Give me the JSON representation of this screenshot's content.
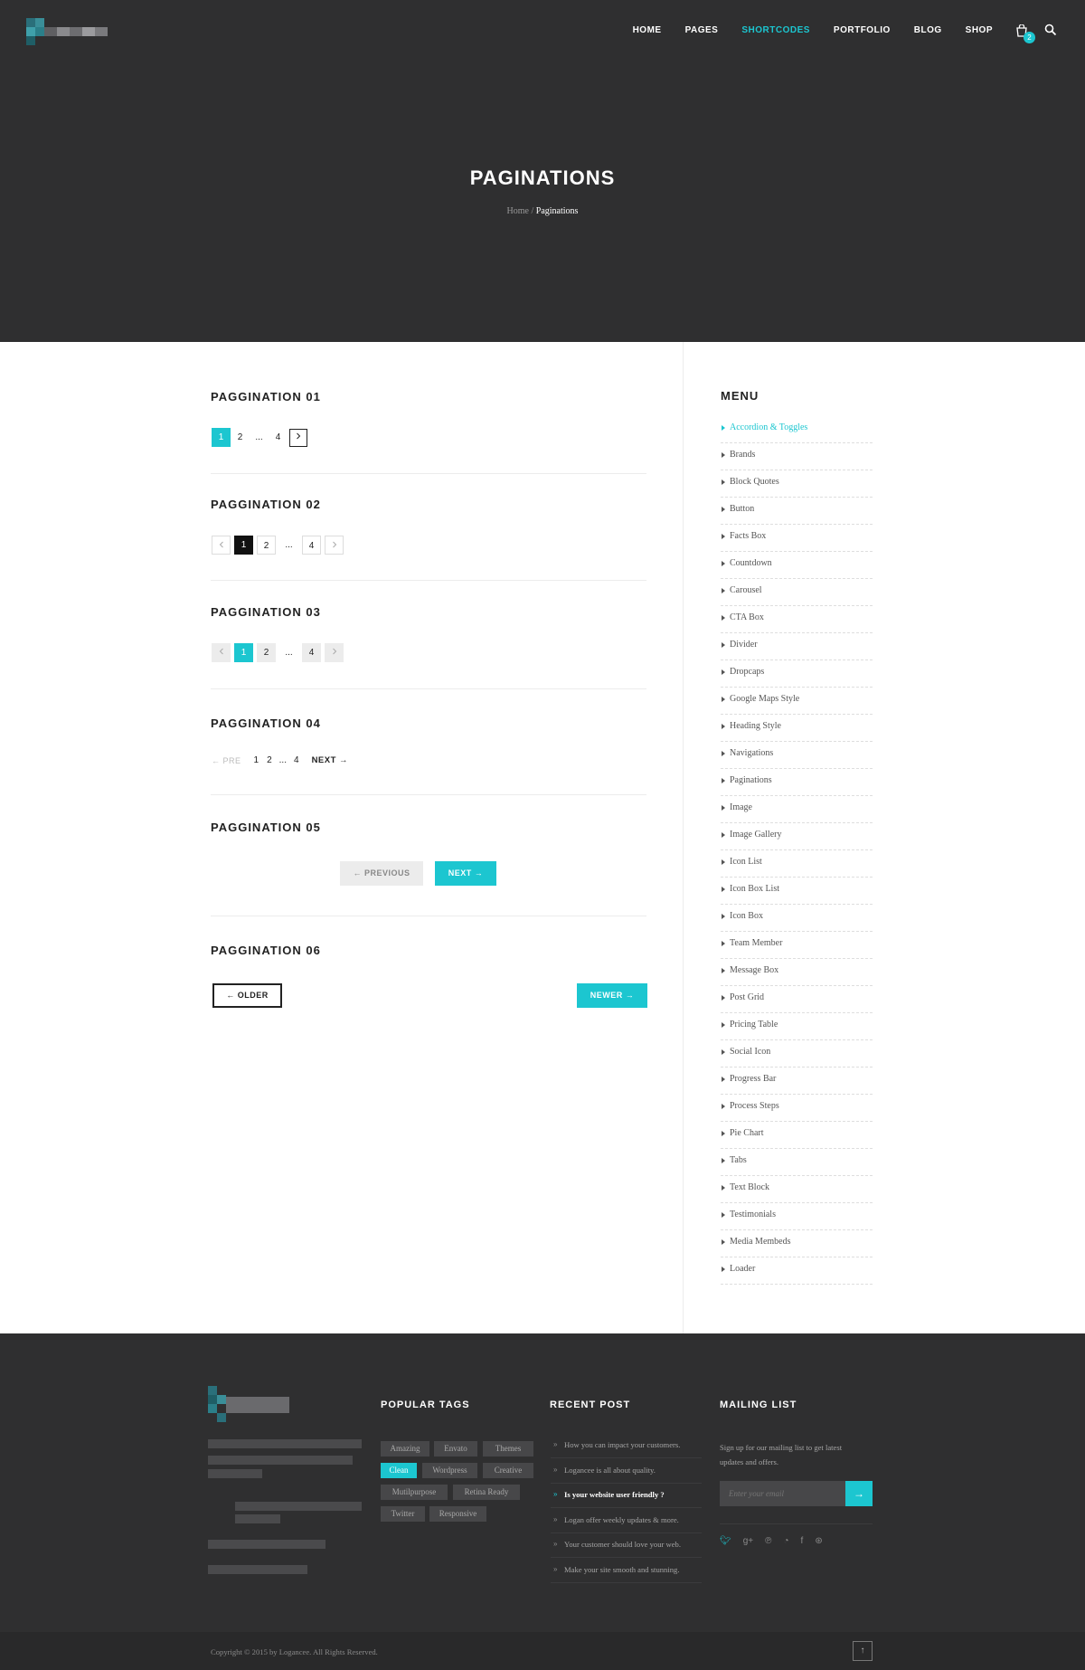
{
  "colors": {
    "accent": "#1cc6d0",
    "dark_bg": "#2f2f30",
    "active_black": "#111111"
  },
  "nav": {
    "items": [
      {
        "label": "HOME",
        "active": false
      },
      {
        "label": "PAGES",
        "active": false
      },
      {
        "label": "SHORTCODES",
        "active": true
      },
      {
        "label": "PORTFOLIO",
        "active": false
      },
      {
        "label": "BLOG",
        "active": false
      },
      {
        "label": "SHOP",
        "active": false
      }
    ],
    "cart_count": "2"
  },
  "hero": {
    "title": "PAGINATIONS",
    "breadcrumb_home": "Home",
    "breadcrumb_sep": " / ",
    "breadcrumb_current": "Paginations"
  },
  "sections": {
    "s1": {
      "title": "PAGGINATION 01",
      "pages": [
        "1",
        "2",
        "...",
        "4"
      ]
    },
    "s2": {
      "title": "PAGGINATION 02",
      "pages": [
        "1",
        "2",
        "...",
        "4"
      ]
    },
    "s3": {
      "title": "PAGGINATION 03",
      "pages": [
        "1",
        "2",
        "...",
        "4"
      ]
    },
    "s4": {
      "title": "PAGGINATION 04",
      "prev": "PRE",
      "pages": [
        "1",
        "2",
        "...",
        "4"
      ],
      "next": "NEXT"
    },
    "s5": {
      "title": "PAGGINATION 05",
      "prev": "PREVIOUS",
      "next": "NEXT"
    },
    "s6": {
      "title": "PAGGINATION 06",
      "older": "OLDER",
      "newer": "NEWER"
    }
  },
  "sidebar": {
    "title": "MENU",
    "items": [
      "Accordion & Toggles",
      "Brands",
      "Block Quotes",
      "Button",
      "Facts Box",
      "Countdown",
      "Carousel",
      "CTA Box",
      "Divider",
      "Dropcaps",
      "Google Maps Style",
      "Heading Style",
      "Navigations",
      "Paginations",
      "Image",
      "Image Gallery",
      "Icon List",
      "Icon Box List",
      "Icon Box",
      "Team Member",
      "Message Box",
      "Post Grid",
      "Pricing Table",
      "Social Icon",
      "Progress Bar",
      "Process Steps",
      "Pie Chart",
      "Tabs",
      "Text Block",
      "Testimonials",
      "Media Membeds",
      "Loader"
    ],
    "active_index": 0
  },
  "footer": {
    "tags_title": "POPULAR TAGS",
    "tags": [
      {
        "label": "Amazing",
        "active": false
      },
      {
        "label": "Envato",
        "active": false
      },
      {
        "label": "Themes",
        "active": false
      },
      {
        "label": "Clean",
        "active": true
      },
      {
        "label": "Wordpress",
        "active": false
      },
      {
        "label": "Creative",
        "active": false
      },
      {
        "label": "Mutilpurpose",
        "active": false
      },
      {
        "label": "Retina Ready",
        "active": false
      },
      {
        "label": "Twitter",
        "active": false
      },
      {
        "label": "Responsive",
        "active": false
      }
    ],
    "recent_title": "RECENT POST",
    "recent": [
      {
        "label": "How you can impact your customers.",
        "bold": false
      },
      {
        "label": "Logancee is all about quality.",
        "bold": false
      },
      {
        "label": "Is your website user friendly ?",
        "bold": true
      },
      {
        "label": "Logan offer weekly updates & more.",
        "bold": false
      },
      {
        "label": "Your customer should love your web.",
        "bold": false
      },
      {
        "label": "Make your site smooth and stunning.",
        "bold": false
      }
    ],
    "mailing_title": "MAILING LIST",
    "mailing_text_1": "Sign up for our mailing list to get latest",
    "mailing_text_2": "updates and offers.",
    "email_placeholder": "Enter your email",
    "social_icons": [
      "twitter-icon",
      "google-plus-icon",
      "pinterest-icon",
      "rss-icon",
      "facebook-icon",
      "dribbble-icon"
    ],
    "copyright": "Copyright © 2015 by Logancee. All Rights Reserved."
  }
}
